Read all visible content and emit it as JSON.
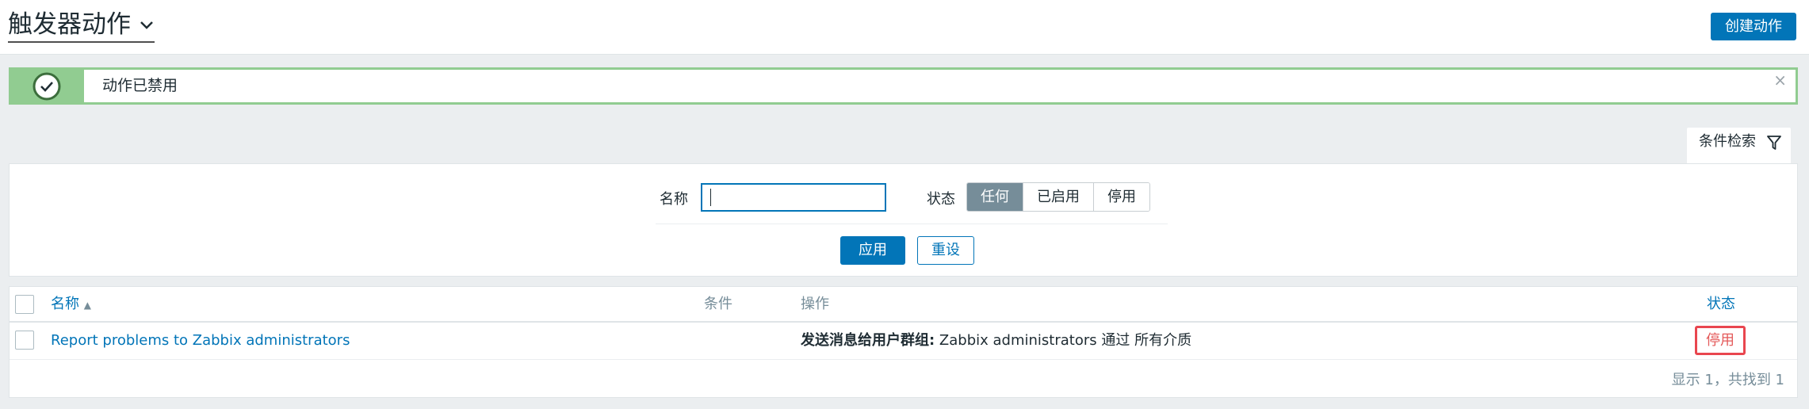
{
  "header": {
    "title": "触发器动作",
    "create_button": "创建动作"
  },
  "message": {
    "text": "动作已禁用",
    "close": "×"
  },
  "filter": {
    "tab_label": "条件检索",
    "name_label": "名称",
    "name_value": "",
    "status_label": "状态",
    "status_options": [
      "任何",
      "已启用",
      "停用"
    ],
    "status_selected": "任何",
    "apply_label": "应用",
    "reset_label": "重设"
  },
  "table": {
    "columns": {
      "name": "名称",
      "sort_indicator": "▲",
      "conditions": "条件",
      "operations": "操作",
      "status": "状态"
    },
    "rows": [
      {
        "name": "Report problems to Zabbix administrators",
        "conditions": "",
        "operation_bold": "发送消息给用户群组:",
        "operation_rest": " Zabbix administrators 通过 所有介质",
        "status": "停用"
      }
    ],
    "footer": "显示 1，共找到 1"
  },
  "colors": {
    "accent": "#0275b8",
    "success": "#91cc91",
    "disabled_status": "#e45959",
    "active_segment": "#768d99"
  },
  "icons": {
    "title_chevron": "chevron-down-icon",
    "message": "check-circle-icon",
    "filter": "filter-icon"
  }
}
